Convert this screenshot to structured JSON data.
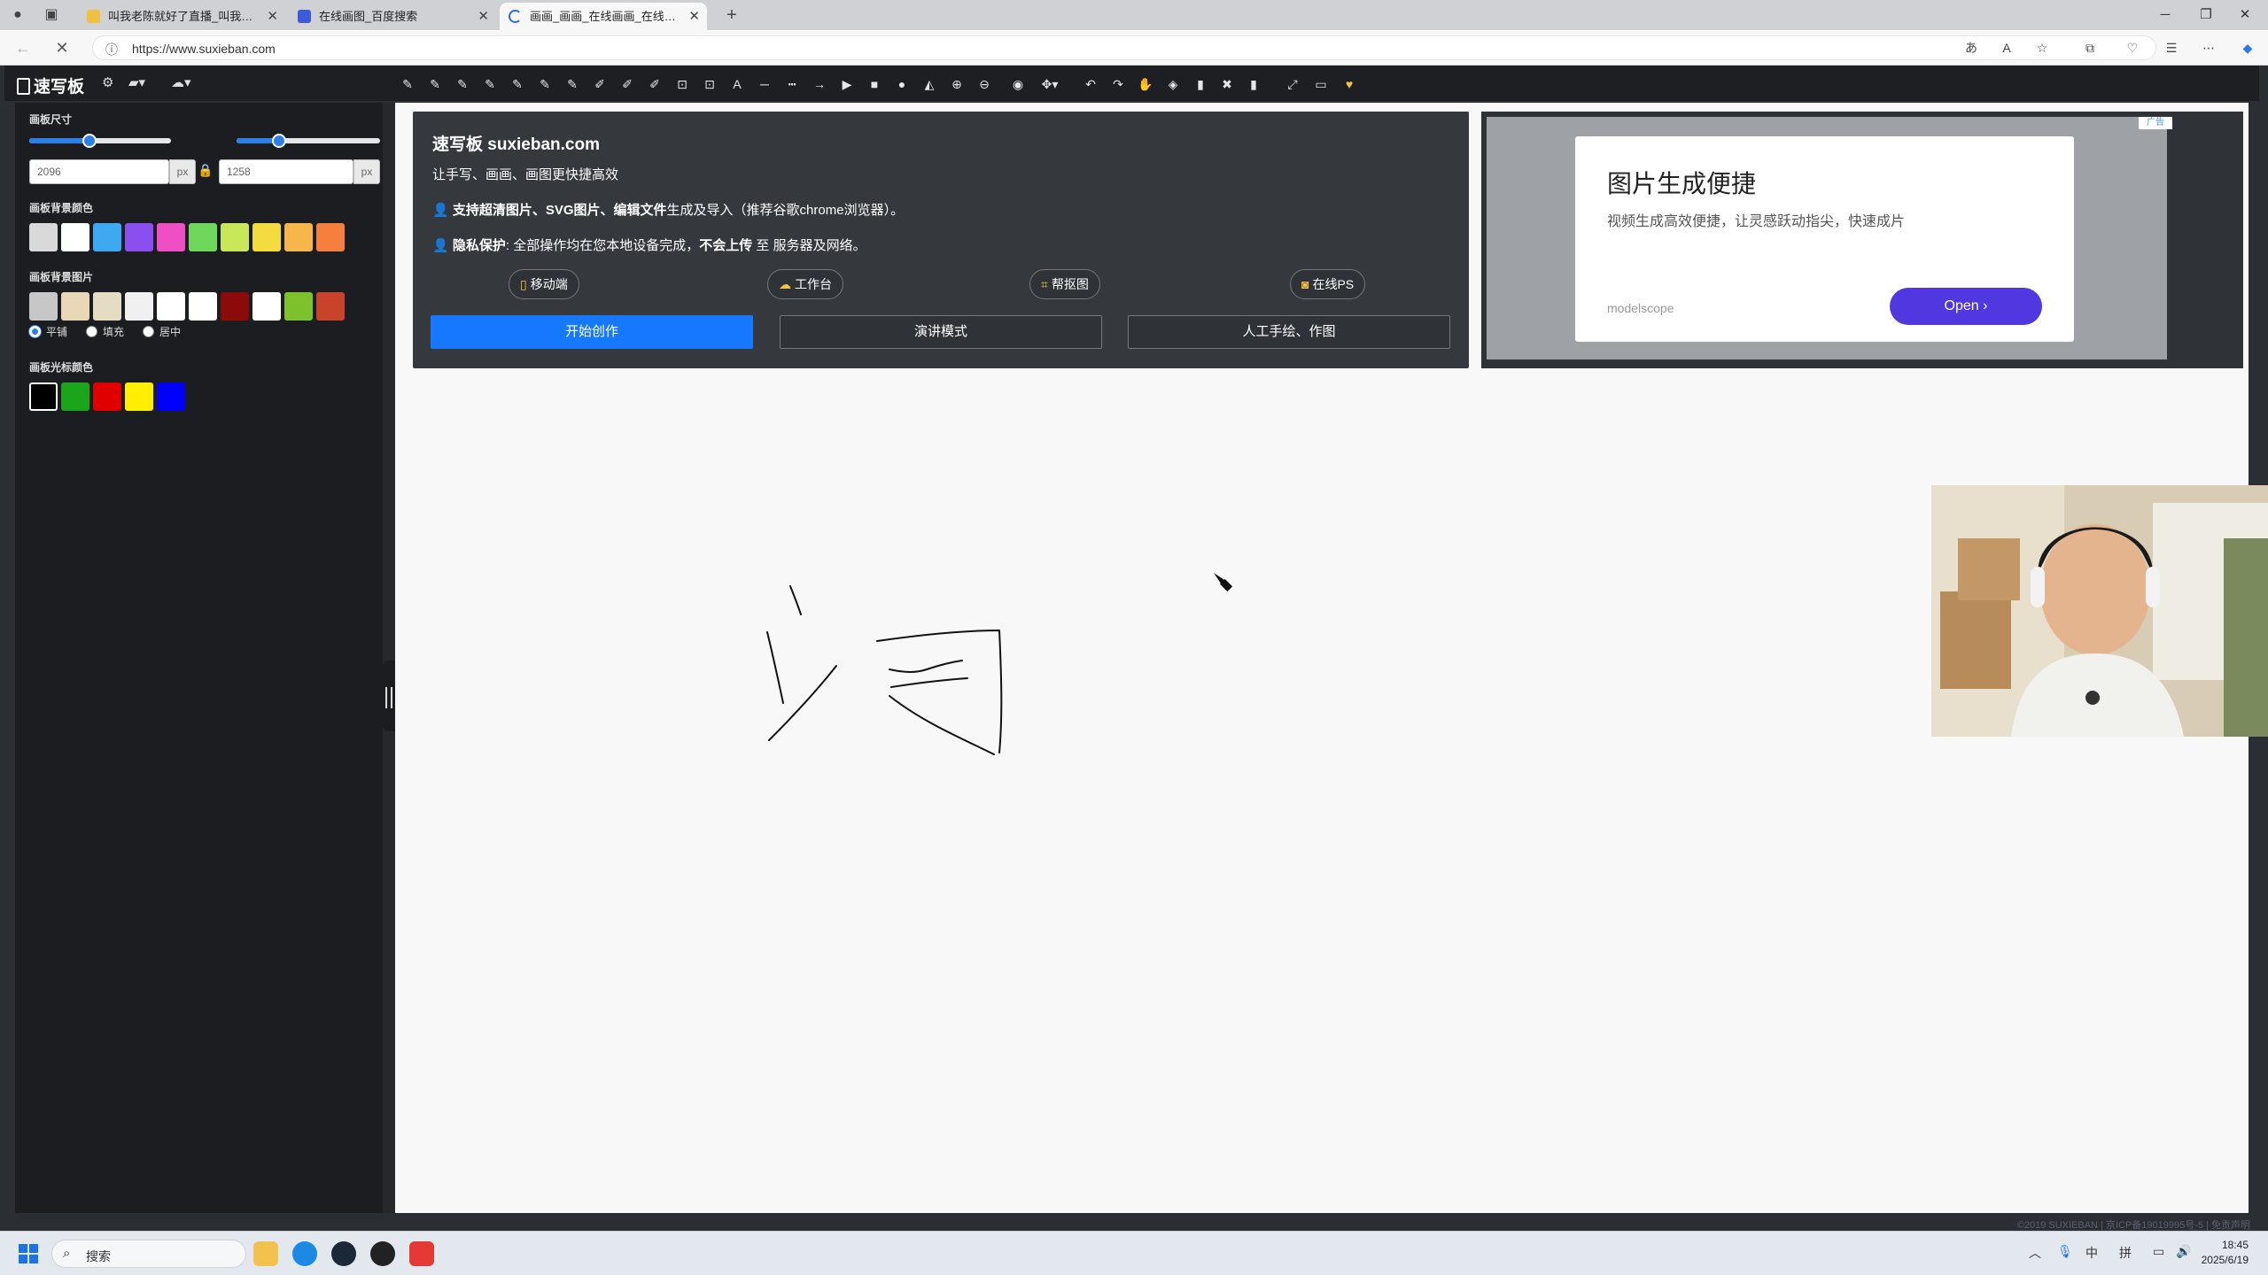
{
  "browser": {
    "tabs": [
      {
        "title": "叫我老陈就好了直播_叫我老陈就好了",
        "active": false
      },
      {
        "title": "在线画图_百度搜索",
        "active": false
      },
      {
        "title": "画画_画画_在线画画_在线画图网站",
        "active": true
      }
    ],
    "url": "https://www.suxieban.com"
  },
  "app": {
    "logo": "速写板",
    "sidebar": {
      "canvas_size_label": "画板尺寸",
      "width_value": "2096",
      "height_value": "1258",
      "unit": "px",
      "width_slider_level": 0.32,
      "height_slider_level": 0.27,
      "bg_color_label": "画板背景颜色",
      "bg_colors": [
        "#d9d9d9",
        "#ffffff",
        "#3ea8f0",
        "#8b4ff0",
        "#ef4fc4",
        "#6fd85c",
        "#c8e85a",
        "#f4dc3e",
        "#f6b64a",
        "#f57f3c"
      ],
      "bg_image_label": "画板背景图片",
      "bg_images": [
        "#c7c7c7",
        "#ead7b8",
        "#e5dcc4",
        "#f0f0f0",
        "#ffffff",
        "#ffffff",
        "#8b0a0a",
        "#ffffff",
        "#7dc22c",
        "#c8432a"
      ],
      "fill_modes": [
        {
          "label": "平铺",
          "checked": true
        },
        {
          "label": "填充",
          "checked": false
        },
        {
          "label": "居中",
          "checked": false
        }
      ],
      "cursor_color_label": "画板光标颜色",
      "cursor_colors": [
        "#000000",
        "#1aa51a",
        "#e00000",
        "#ffee00",
        "#0000ff"
      ]
    },
    "info_card": {
      "title": "速写板 suxieban.com",
      "line1": "让手写、画画、画图更快捷高效",
      "line2_bold": "支持超清图片、SVG图片、编辑文件",
      "line2_rest": "生成及导入（推荐谷歌chrome浏览器）。",
      "line3_bold": "隐私保护",
      "line3_mid": ": 全部操作均在您本地设备完成，",
      "line3_bold2": "不会上传",
      "line3_rest": " 至 服务器及网络。",
      "pills": [
        "移动端",
        "工作台",
        "帮抠图",
        "在线PS"
      ],
      "buttons": [
        "开始创作",
        "演讲模式",
        "人工手绘、作图"
      ]
    },
    "ad": {
      "badge": "广告",
      "title": "图片生成便捷",
      "subtitle": "视频生成高效便捷，让灵感跃动指尖，快速成片",
      "source": "modelscope",
      "cta": "Open"
    },
    "footer": "©2019 SUXIEBAN | 京ICP备19019995号-5 | 免责声明"
  },
  "taskbar": {
    "search_placeholder": "搜索",
    "ime": "中",
    "ime2": "拼",
    "time": "18:45",
    "date": "2025/6/19"
  },
  "colors": {
    "primary": "#1677ff",
    "ad_cta": "#5137e0",
    "toolbar_bg": "#1e1f22",
    "accent_gold": "#f6c445"
  }
}
